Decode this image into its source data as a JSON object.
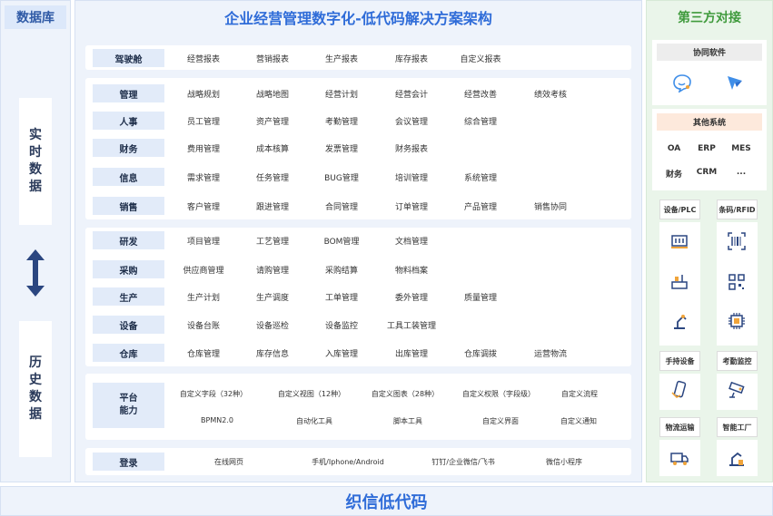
{
  "left": {
    "title": "数据库",
    "realtime": [
      "实",
      "时",
      "数",
      "据"
    ],
    "history": [
      "历",
      "史",
      "数",
      "据"
    ]
  },
  "header": {
    "title": "企业经营管理数字化-低代码解决方案架构"
  },
  "sections": {
    "cockpit": {
      "label": "驾驶舱",
      "items": [
        "经营报表",
        "营销报表",
        "生产报表",
        "库存报表",
        "自定义报表"
      ]
    },
    "group1": [
      {
        "label": "管理",
        "items": [
          "战略规划",
          "战略地图",
          "经营计划",
          "经营会计",
          "经营改善",
          "绩效考核"
        ]
      },
      {
        "label": "人事",
        "items": [
          "员工管理",
          "资产管理",
          "考勤管理",
          "会议管理",
          "综合管理"
        ]
      },
      {
        "label": "财务",
        "items": [
          "费用管理",
          "成本核算",
          "发票管理",
          "财务报表"
        ]
      },
      {
        "label": "信息",
        "items": [
          "需求管理",
          "任务管理",
          "BUG管理",
          "培训管理",
          "系统管理"
        ]
      },
      {
        "label": "销售",
        "items": [
          "客户管理",
          "跟进管理",
          "合同管理",
          "订单管理",
          "产品管理",
          "销售协同"
        ]
      }
    ],
    "group2": [
      {
        "label": "研发",
        "items": [
          "项目管理",
          "工艺管理",
          "BOM管理",
          "文档管理"
        ]
      },
      {
        "label": "采购",
        "items": [
          "供应商管理",
          "请购管理",
          "采购结算",
          "物料档案"
        ]
      },
      {
        "label": "生产",
        "items": [
          "生产计划",
          "生产调度",
          "工单管理",
          "委外管理",
          "质量管理"
        ]
      },
      {
        "label": "设备",
        "items": [
          "设备台账",
          "设备巡检",
          "设备监控",
          "工具工装管理"
        ]
      },
      {
        "label": "仓库",
        "items": [
          "仓库管理",
          "库存信息",
          "入库管理",
          "出库管理",
          "仓库调拨",
          "运营物流"
        ]
      }
    ],
    "platform": {
      "label1": "平台",
      "label2": "能力",
      "row1": [
        "自定义字段（32种）",
        "自定义视图（12种）",
        "自定义图表（28种）",
        "自定义权限（字段级）",
        "自定义流程"
      ],
      "row2": [
        "BPMN2.0",
        "自动化工具",
        "脚本工具",
        "自定义界面",
        "自定义通知"
      ]
    },
    "login": {
      "label": "登录",
      "items": [
        "在线网页",
        "手机/Iphone/Android",
        "钉钉/企业微信/飞书",
        "微信小程序"
      ]
    }
  },
  "right": {
    "title": "第三方对接",
    "collab": {
      "title": "协同软件",
      "icons": [
        "dingtalk-icon",
        "feishu-icon"
      ]
    },
    "other": {
      "title": "其他系统",
      "row1": [
        "OA",
        "ERP",
        "MES"
      ],
      "row2": [
        "财务",
        "CRM",
        "..."
      ]
    },
    "devices": {
      "plc": "设备/PLC",
      "rfid": "条码/RFID",
      "handheld": "手持设备",
      "attendance": "考勤监控",
      "logistics": "物流运输",
      "factory": "智能工厂"
    }
  },
  "footer": {
    "title": "织信低代码"
  },
  "colors": {
    "accent": "#2f6cd8",
    "green": "#3f9a3c",
    "navy": "#2b4680"
  }
}
